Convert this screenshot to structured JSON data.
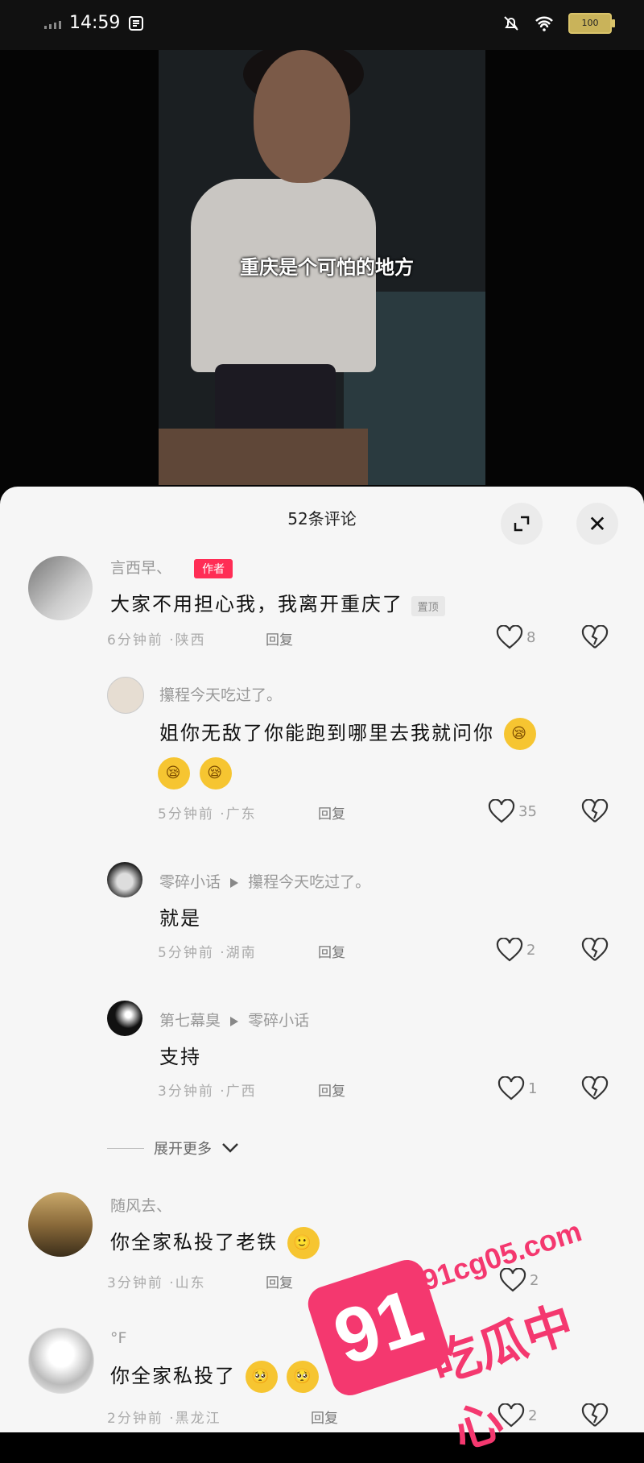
{
  "status": {
    "time": "14:59",
    "battery": "100"
  },
  "video": {
    "caption": "重庆是个可怕的地方"
  },
  "sheet": {
    "title": "52条评论"
  },
  "comments": [
    {
      "name": "言西早、",
      "author_tag": "作者",
      "text": "大家不用担心我，我离开重庆了",
      "pin_tag": "置顶",
      "time": "6分钟前",
      "location": "·陕西",
      "reply": "回复",
      "likes": "8"
    },
    {
      "name": "攥程今天吃过了。",
      "text_line1": "姐你无敌了你能跑到哪里去我就问你",
      "text_line2": "",
      "time": "5分钟前",
      "location": "·广东",
      "reply": "回复",
      "likes": "35"
    },
    {
      "name": "零碎小话",
      "reply_to": "攥程今天吃过了。",
      "text": "就是",
      "time": "5分钟前",
      "location": "·湖南",
      "reply": "回复",
      "likes": "2"
    },
    {
      "name": "第七幕臭",
      "reply_to": "零碎小话",
      "text": "支持",
      "time": "3分钟前",
      "location": "·广西",
      "reply": "回复",
      "likes": "1"
    },
    {
      "name": "随风去、",
      "text": "你全家私投了老铁",
      "time": "3分钟前",
      "location": "·山东",
      "reply": "回复",
      "likes": "2"
    },
    {
      "name": "°F",
      "text": "你全家私投了",
      "time": "2分钟前",
      "location": "·黑龙江",
      "reply": "回复",
      "likes": "2"
    }
  ],
  "expand_label": "展开更多",
  "watermark": {
    "number": "91",
    "url": "91cg05.com",
    "name": "吃瓜中心"
  },
  "colors": {
    "accent": "#ff2d55",
    "watermark": "#f4386f"
  }
}
